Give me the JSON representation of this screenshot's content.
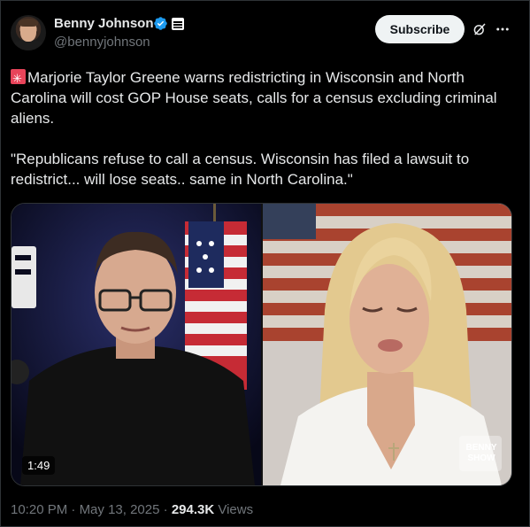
{
  "author": {
    "name": "Benny Johnson",
    "handle": "@bennyjohnson"
  },
  "actions": {
    "subscribe_label": "Subscribe"
  },
  "tweet": {
    "paragraph1": "Marjorie Taylor Greene warns redistricting in Wisconsin and North Carolina will cost GOP House seats, calls for a census excluding criminal aliens.",
    "paragraph2": "\"Republicans refuse to call a census. Wisconsin has filed a lawsuit to redistrict... will lose seats.. same in North Carolina.\""
  },
  "media": {
    "duration": "1:49",
    "watermark": "BENNY SHOW"
  },
  "meta": {
    "time": "10:20 PM",
    "separator1": " · ",
    "date": "May 13, 2025",
    "separator2": " · ",
    "views_count": "294.3K",
    "views_label": " Views"
  },
  "colors": {
    "background": "#000000",
    "text": "#e7e9ea",
    "muted": "#71767b",
    "verified": "#1d9bf0",
    "subscribe_bg": "#eff3f4"
  },
  "icons": [
    "verified-badge-icon",
    "affiliate-badge-icon",
    "grok-icon",
    "more-icon",
    "emoji-red-icon"
  ]
}
